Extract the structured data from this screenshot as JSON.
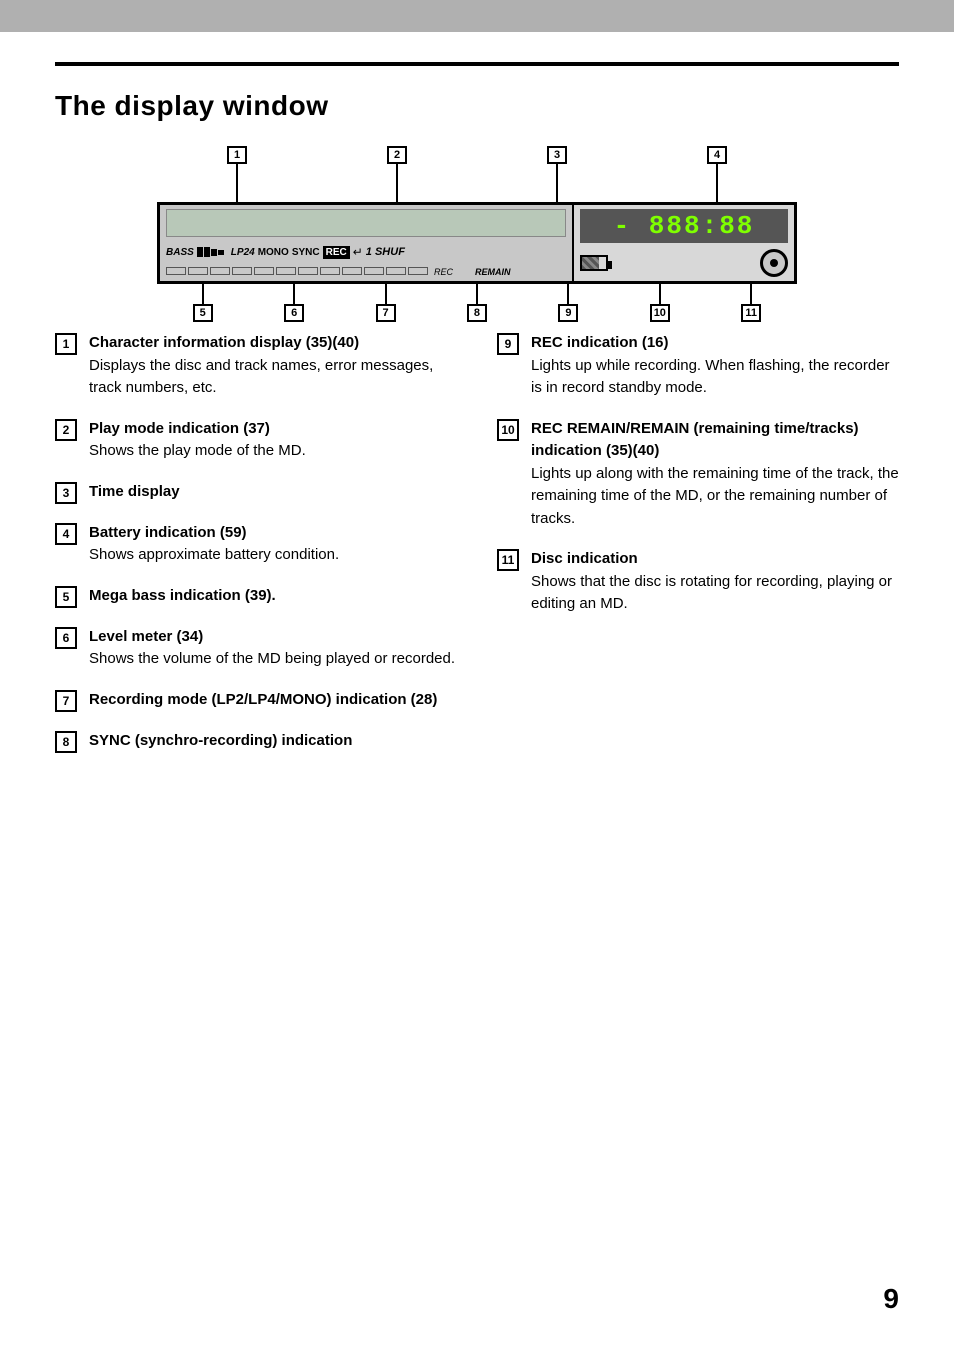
{
  "topBar": {},
  "title": "The display window",
  "diagram": {
    "timeDisplay": "- 888:88",
    "bassLabel": "BASS",
    "lp24Label": "LP24",
    "monoLabel": "MONO",
    "syncLabel": "SYNC",
    "recBtnLabel": "REC",
    "arrowLabel": "↵",
    "shuffleLabel": "1 SHUF",
    "recSmallLabel": "REC",
    "remainLabel": "REMAIN"
  },
  "topCallouts": [
    {
      "num": "1",
      "lineHeight": 40
    },
    {
      "num": "2",
      "lineHeight": 40
    },
    {
      "num": "3",
      "lineHeight": 40
    },
    {
      "num": "4",
      "lineHeight": 40
    }
  ],
  "bottomCallouts": [
    {
      "num": "5"
    },
    {
      "num": "6"
    },
    {
      "num": "7"
    },
    {
      "num": "8"
    },
    {
      "num": "9"
    },
    {
      "num": "10"
    },
    {
      "num": "11"
    }
  ],
  "leftItems": [
    {
      "num": "1",
      "title": "Character information display (35)(40)",
      "body": "Displays the disc and track names, error messages, track numbers, etc."
    },
    {
      "num": "2",
      "title": "Play mode indication (37)",
      "body": "Shows the play mode of the MD."
    },
    {
      "num": "3",
      "title": "Time display",
      "body": ""
    },
    {
      "num": "4",
      "title": "Battery indication (59)",
      "body": "Shows approximate battery condition."
    },
    {
      "num": "5",
      "title": "Mega bass indication (39).",
      "body": ""
    },
    {
      "num": "6",
      "title": "Level meter (34)",
      "body": "Shows the volume of the MD being played or recorded."
    },
    {
      "num": "7",
      "title": "Recording mode (LP2/LP4/MONO) indication (28)",
      "body": ""
    },
    {
      "num": "8",
      "title": "SYNC (synchro-recording) indication",
      "body": ""
    }
  ],
  "rightItems": [
    {
      "num": "9",
      "title": "REC indication (16)",
      "body": "Lights up while recording. When flashing, the recorder is in record standby mode."
    },
    {
      "num": "10",
      "title": "REC REMAIN/REMAIN (remaining time/tracks) indication (35)(40)",
      "body": "Lights up along with the remaining time of the track, the remaining time of the MD, or the remaining number of tracks."
    },
    {
      "num": "11",
      "title": "Disc indication",
      "body": "Shows that the disc is rotating for recording, playing or editing an MD."
    }
  ],
  "pageNumber": "9"
}
